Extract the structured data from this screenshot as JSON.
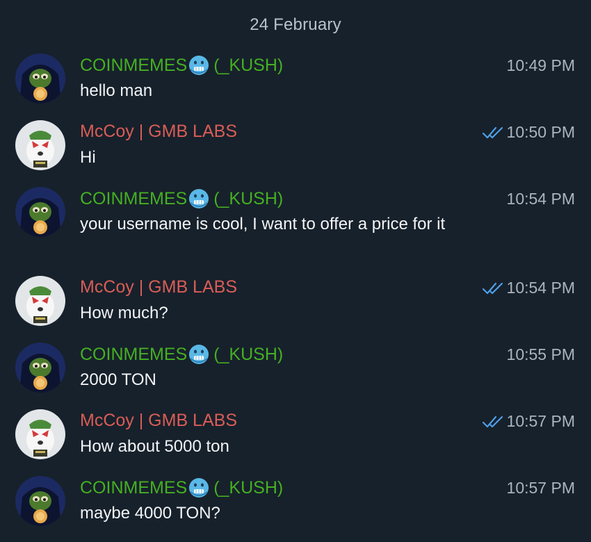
{
  "date_separator": "24 February",
  "colors": {
    "background": "#17212b",
    "sender_green": "#45b022",
    "sender_red": "#d95d57",
    "read_ticks": "#4f9fe8"
  },
  "messages": [
    {
      "sender": "COINMEMES",
      "sender_suffix": "(_KUSH)",
      "sender_emoji": "freezing-face-icon",
      "text": "hello man",
      "time": "10:49 PM",
      "read": false
    },
    {
      "sender": "McCoy | GMB LABS",
      "sender_suffix": "",
      "text": "Hi",
      "time": "10:50 PM",
      "read": true
    },
    {
      "sender": "COINMEMES",
      "sender_suffix": "(_KUSH)",
      "sender_emoji": "freezing-face-icon",
      "text": "your username is cool, I want to offer a price for it",
      "time": "10:54 PM",
      "read": false
    },
    {
      "sender": "McCoy | GMB LABS",
      "sender_suffix": "",
      "text": "How much?",
      "time": "10:54 PM",
      "read": true
    },
    {
      "sender": "COINMEMES",
      "sender_suffix": "(_KUSH)",
      "sender_emoji": "freezing-face-icon",
      "text": "2000 TON",
      "time": "10:55 PM",
      "read": false
    },
    {
      "sender": "McCoy | GMB LABS",
      "sender_suffix": "",
      "text": "How about 5000 ton",
      "time": "10:57 PM",
      "read": true
    },
    {
      "sender": "COINMEMES",
      "sender_suffix": "(_KUSH)",
      "sender_emoji": "freezing-face-icon",
      "text": "maybe 4000 TON?",
      "time": "10:57 PM",
      "read": false
    }
  ]
}
